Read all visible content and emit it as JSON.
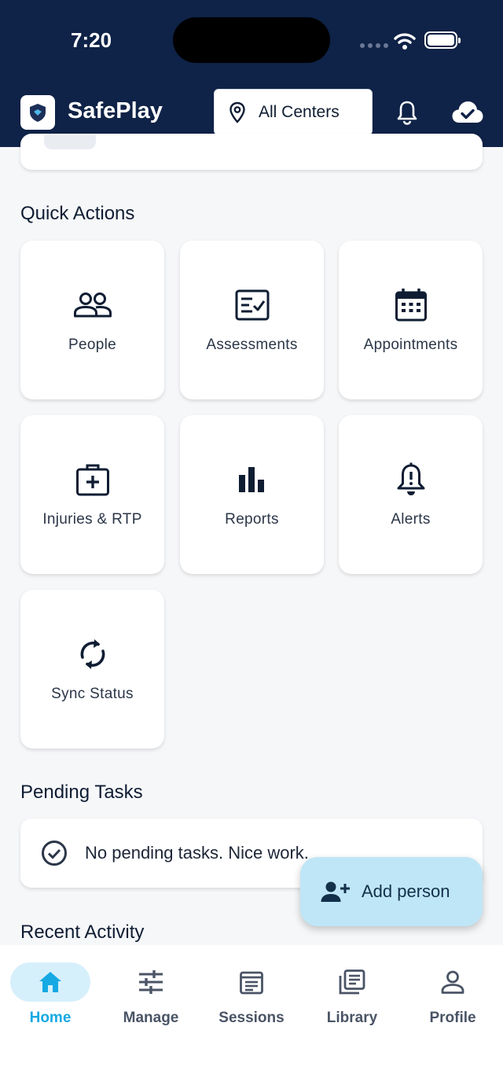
{
  "status_bar": {
    "time": "7:20"
  },
  "header": {
    "app_title": "SafePlay",
    "center_selector": "All Centers"
  },
  "quick_actions": {
    "title": "Quick Actions",
    "items": [
      {
        "label": "People",
        "icon": "people-icon"
      },
      {
        "label": "Assessments",
        "icon": "assessment-checklist-icon"
      },
      {
        "label": "Appointments",
        "icon": "calendar-icon"
      },
      {
        "label": "Injuries & RTP",
        "icon": "medical-kit-icon"
      },
      {
        "label": "Reports",
        "icon": "bar-chart-icon"
      },
      {
        "label": "Alerts",
        "icon": "alert-bell-icon"
      },
      {
        "label": "Sync Status",
        "icon": "sync-icon"
      }
    ]
  },
  "pending_tasks": {
    "title": "Pending Tasks",
    "message": "No pending tasks. Nice work."
  },
  "recent_activity": {
    "title": "Recent Activity"
  },
  "fab": {
    "label": "Add person"
  },
  "bottom_nav": {
    "items": [
      {
        "label": "Home",
        "active": true
      },
      {
        "label": "Manage",
        "active": false
      },
      {
        "label": "Sessions",
        "active": false
      },
      {
        "label": "Library",
        "active": false
      },
      {
        "label": "Profile",
        "active": false
      }
    ]
  },
  "colors": {
    "header_bg": "#0f2247",
    "accent": "#17a9e3",
    "fab_bg": "#bfe6f7",
    "page_bg": "#f6f7f9"
  }
}
